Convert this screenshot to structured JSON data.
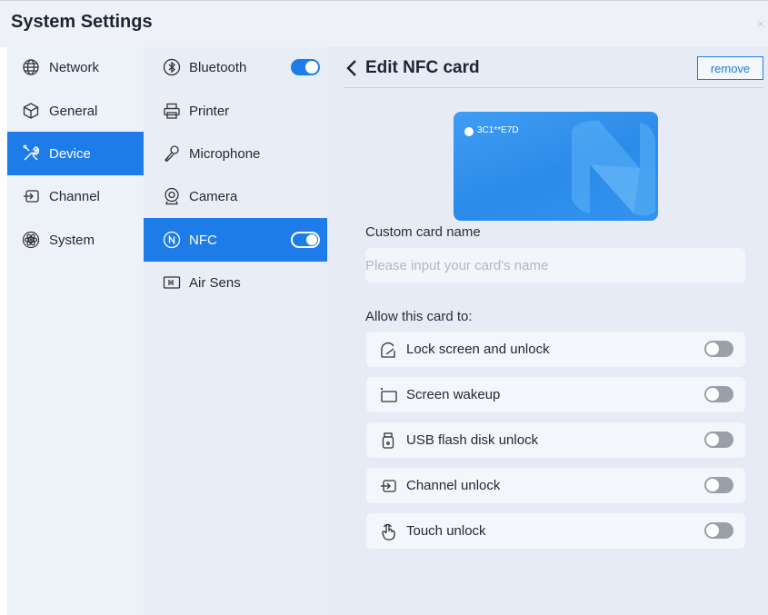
{
  "window": {
    "title": "System Settings",
    "close_glyph": "×"
  },
  "categories": [
    {
      "label": "Network",
      "icon": "globe-icon",
      "active": false
    },
    {
      "label": "General",
      "icon": "cube-icon",
      "active": false
    },
    {
      "label": "Device",
      "icon": "tools-icon",
      "active": true
    },
    {
      "label": "Channel",
      "icon": "channel-icon",
      "active": false
    },
    {
      "label": "System",
      "icon": "atom-icon",
      "active": false
    }
  ],
  "devices": [
    {
      "label": "Bluetooth",
      "icon": "bluetooth-icon",
      "toggle": "on"
    },
    {
      "label": "Printer",
      "icon": "printer-icon",
      "toggle": null
    },
    {
      "label": "Microphone",
      "icon": "microphone-icon",
      "toggle": null
    },
    {
      "label": "Camera",
      "icon": "camera-icon",
      "toggle": null
    },
    {
      "label": "NFC",
      "icon": "nfc-icon",
      "toggle": "on",
      "active": true
    },
    {
      "label": "Air Sens",
      "icon": "air-sensor-icon",
      "toggle": null
    }
  ],
  "detail": {
    "title": "Edit NFC card",
    "remove_label": "remove",
    "card": {
      "number": "3C1**E7D",
      "color": "#2b8be9"
    },
    "name_label": "Custom card name",
    "name_value": "",
    "name_placeholder": "Please input your card's name",
    "allow_label": "Allow this card to:",
    "permissions": [
      {
        "label": "Lock screen and unlock",
        "icon": "lock-screen-icon",
        "enabled": false
      },
      {
        "label": "Screen wakeup",
        "icon": "screen-wakeup-icon",
        "enabled": false
      },
      {
        "label": "USB flash disk unlock",
        "icon": "usb-icon",
        "enabled": false
      },
      {
        "label": "Channel unlock",
        "icon": "channel-icon",
        "enabled": false
      },
      {
        "label": "Touch unlock",
        "icon": "touch-icon",
        "enabled": false
      }
    ]
  },
  "colors": {
    "accent": "#1e7ce8",
    "panel": "#e6ebf5",
    "toggle_off": "#9aa0a8"
  }
}
